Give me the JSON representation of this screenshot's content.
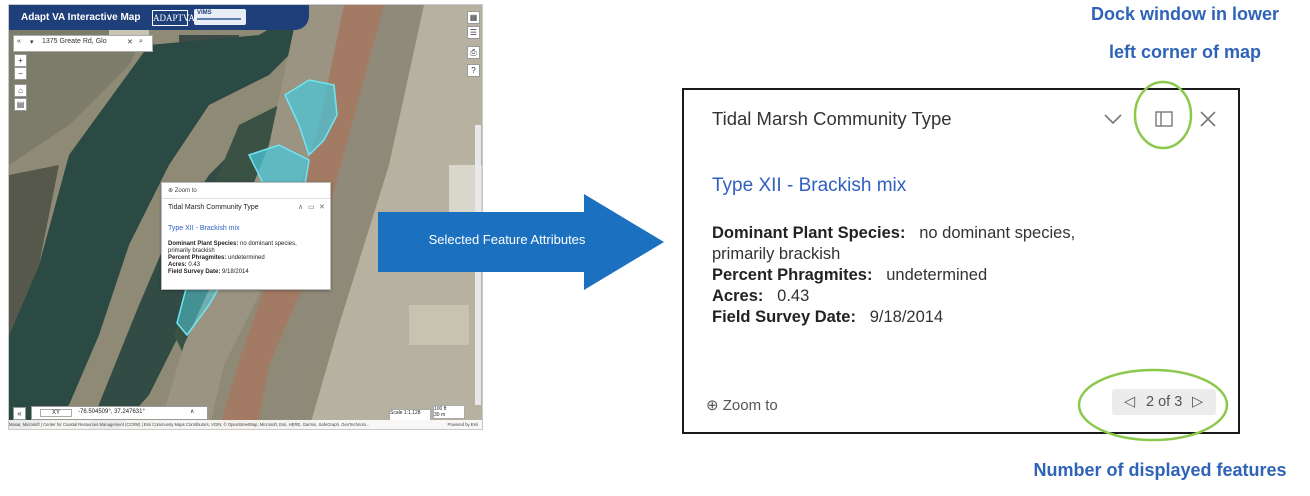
{
  "map": {
    "app_title": "Adapt VA Interactive Map",
    "logo_text": "ADAPTVA",
    "logo2_text": "VIMS",
    "search_value": "1375 Greate Rd, Glo",
    "zoom_in": "+",
    "zoom_out": "−",
    "popup": {
      "zoom_label": "Zoom to",
      "title": "Tidal Marsh Community Type",
      "heading": "Type XII - Brackish mix",
      "rows": [
        {
          "label": "Dominant Plant Species:",
          "value": "no dominant species,"
        },
        {
          "label": "",
          "value": "primarily brackish"
        },
        {
          "label": "Percent Phragmites:",
          "value": "undetermined"
        },
        {
          "label": "Acres:",
          "value": "0.43"
        },
        {
          "label": "Field Survey Date:",
          "value": "9/18/2014"
        }
      ]
    },
    "coord_mode": "XY",
    "coord_value": "-76.504509°, 37.247631°",
    "scale": "Scale 1:1,128",
    "scale_bar_top": "100 ft",
    "scale_bar_bottom": "30 m",
    "attribution": "Maxar, Microsoft | Center for Coastal Resources Management (CCRM) | Esri Community Maps Contributors, VGIN, © OpenStreetMap, Microsoft, Esri, HERE, Garmin, SafeGraph, GeoTechnolo...",
    "powered_by": "Powered by Esri",
    "colors": {
      "header": "#1f3f7a",
      "marsh": "#4cc4d6"
    }
  },
  "arrow_label": "Selected Feature Attributes",
  "popup": {
    "title": "Tidal Marsh Community Type",
    "heading": "Type XII - Brackish mix",
    "fields": [
      {
        "label": "Dominant Plant Species:",
        "value": "no dominant species,"
      },
      {
        "label": "",
        "value": "primarily brackish"
      },
      {
        "label": "Percent Phragmites:",
        "value": "undetermined"
      },
      {
        "label": "Acres:",
        "value": "0.43"
      },
      {
        "label": "Field Survey Date:",
        "value": "9/18/2014"
      }
    ],
    "zoom_label": "Zoom to",
    "pager_text": "2 of 3"
  },
  "callouts": {
    "dock_line1": "Dock window in lower",
    "dock_line2": "left corner of map",
    "count": "Number of displayed features"
  },
  "colors": {
    "callout": "#2f63b8",
    "arrow": "#1b70c0",
    "highlight": "#8cc84b",
    "link": "#2f5fbf"
  }
}
